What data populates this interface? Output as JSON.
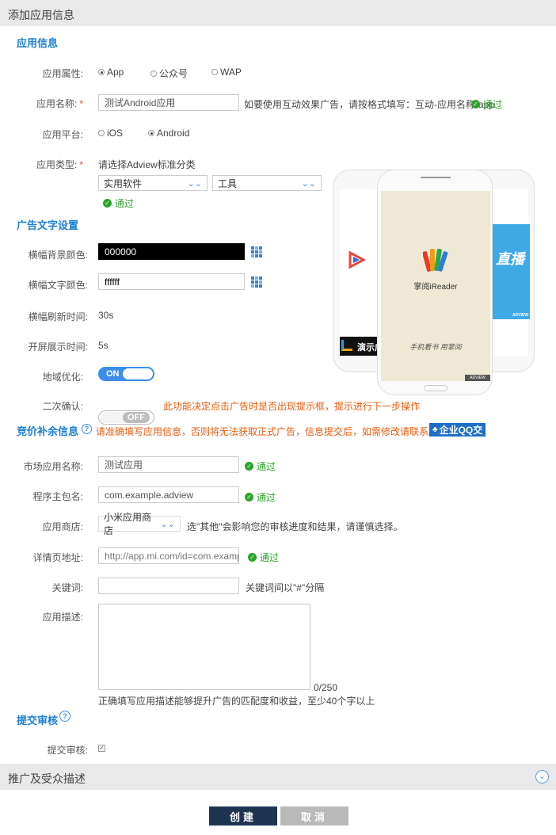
{
  "header": {
    "title": "添加应用信息"
  },
  "app_info": {
    "section_title": "应用信息",
    "attribute": {
      "label": "应用属性:",
      "options": [
        "App",
        "公众号",
        "WAP"
      ],
      "selected": "App"
    },
    "name": {
      "label": "应用名称:",
      "required_mark": "*",
      "value": "测试Android应用",
      "hint": "如要使用互动效果广告，请按格式填写：互动-应用名称-app",
      "status": "通过"
    },
    "platform": {
      "label": "应用平台:",
      "options": [
        "iOS",
        "Android"
      ],
      "selected": "Android"
    },
    "category": {
      "label": "应用类型:",
      "required_mark": "*",
      "hint": "请选择Adview标准分类",
      "primary": "实用软件",
      "secondary": "工具",
      "status": "通过"
    }
  },
  "ad_text": {
    "section_title": "广告文字设置",
    "bg_color": {
      "label": "横幅背景颜色:",
      "value": "000000",
      "swatch": "#000000"
    },
    "text_color": {
      "label": "横幅文字颜色:",
      "value": "ffffff",
      "swatch": "#ffffff"
    },
    "refresh": {
      "label": "横幅刷新时间:",
      "value": "30s"
    },
    "splash": {
      "label": "开屏展示时间:",
      "value": "5s"
    },
    "geo": {
      "label": "地域优化:",
      "state": "ON"
    },
    "confirm": {
      "label": "二次确认:",
      "state": "OFF",
      "warning": "此功能决定点击广告时是否出现提示框，提示进行下一步操作"
    }
  },
  "preview": {
    "left_banner_text": "演示广",
    "center_app_name": "掌阅iReader",
    "center_slogan": "手机看书 用掌阅",
    "right_banner_text": "直播",
    "badge": "ADVIEW",
    "accent_color": "#3fa9e6"
  },
  "bid": {
    "section_title": "竞价补余信息",
    "notice": "请准确填写应用信息，否则将无法获取正式广告，信息提交后，如需修改请联系AdView客服",
    "qq_button": "企业QQ交",
    "market_name": {
      "label": "市场应用名称:",
      "value": "测试应用",
      "status": "通过"
    },
    "package": {
      "label": "程序主包名:",
      "value": "com.example.adview",
      "status": "通过"
    },
    "store": {
      "label": "应用商店:",
      "value": "小米应用商店",
      "hint": "选\"其他\"会影响您的审核进度和结果，请谨慎选择。"
    },
    "detail_url": {
      "label": "详情页地址:",
      "value": "http://app.mi.com/id=com.example",
      "status": "通过"
    },
    "keywords": {
      "label": "关键词:",
      "value": "",
      "hint": "关键词间以\"#\"分隔"
    },
    "description": {
      "label": "应用描述:",
      "value": "",
      "counter": "0/250",
      "hint": "正确填写应用描述能够提升广告的匹配度和收益，至少40个字以上"
    }
  },
  "submit_review": {
    "section_title": "提交审核",
    "label": "提交审核:",
    "checked": true
  },
  "promo": {
    "title": "推广及受众描述"
  },
  "actions": {
    "create": "创建",
    "cancel": "取消"
  }
}
